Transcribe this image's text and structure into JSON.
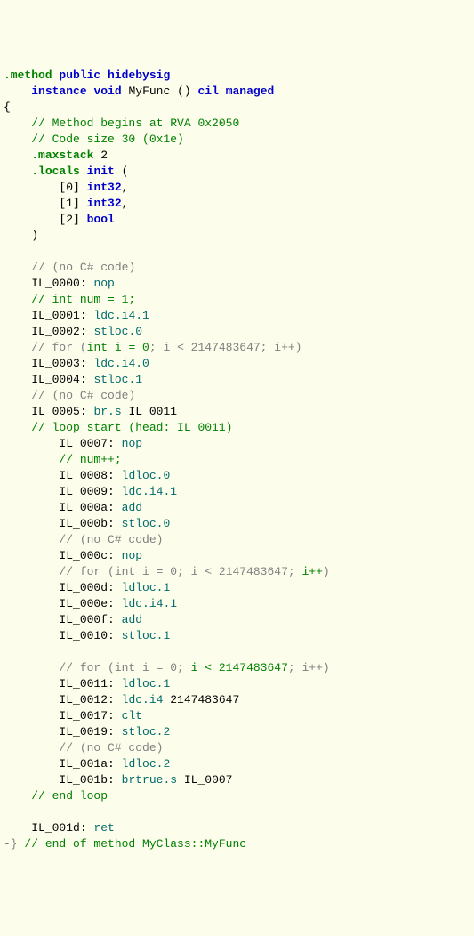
{
  "lines": [
    {
      "indent": 0,
      "parts": [
        {
          "cls": "kw-dir",
          "t": ".method"
        },
        {
          "cls": "plain",
          "t": " "
        },
        {
          "cls": "kw-blue",
          "t": "public"
        },
        {
          "cls": "plain",
          "t": " "
        },
        {
          "cls": "kw-blue",
          "t": "hidebysig"
        }
      ]
    },
    {
      "indent": 4,
      "parts": [
        {
          "cls": "kw-blue",
          "t": "instance"
        },
        {
          "cls": "plain",
          "t": " "
        },
        {
          "cls": "kw-blue",
          "t": "void"
        },
        {
          "cls": "plain",
          "t": " MyFunc () "
        },
        {
          "cls": "kw-blue",
          "t": "cil managed"
        }
      ]
    },
    {
      "indent": 0,
      "parts": [
        {
          "cls": "plain",
          "t": "{"
        }
      ]
    },
    {
      "indent": 4,
      "parts": [
        {
          "cls": "comment",
          "t": "// Method begins at RVA 0x2050"
        }
      ]
    },
    {
      "indent": 4,
      "parts": [
        {
          "cls": "comment",
          "t": "// Code size 30 (0x1e)"
        }
      ]
    },
    {
      "indent": 4,
      "parts": [
        {
          "cls": "kw-dir",
          "t": ".maxstack"
        },
        {
          "cls": "plain",
          "t": " 2"
        }
      ]
    },
    {
      "indent": 4,
      "parts": [
        {
          "cls": "kw-dir",
          "t": ".locals"
        },
        {
          "cls": "plain",
          "t": " "
        },
        {
          "cls": "kw-blue",
          "t": "init"
        },
        {
          "cls": "plain",
          "t": " ("
        }
      ]
    },
    {
      "indent": 8,
      "parts": [
        {
          "cls": "plain",
          "t": "[0] "
        },
        {
          "cls": "kw-type",
          "t": "int32"
        },
        {
          "cls": "plain",
          "t": ","
        }
      ]
    },
    {
      "indent": 8,
      "parts": [
        {
          "cls": "plain",
          "t": "[1] "
        },
        {
          "cls": "kw-type",
          "t": "int32"
        },
        {
          "cls": "plain",
          "t": ","
        }
      ]
    },
    {
      "indent": 8,
      "parts": [
        {
          "cls": "plain",
          "t": "[2] "
        },
        {
          "cls": "kw-type",
          "t": "bool"
        }
      ]
    },
    {
      "indent": 4,
      "parts": [
        {
          "cls": "plain",
          "t": ")"
        }
      ]
    },
    {
      "indent": 0,
      "parts": []
    },
    {
      "indent": 4,
      "parts": [
        {
          "cls": "comment-grey",
          "t": "// "
        },
        {
          "cls": "comment-grey",
          "t": "(no C# code)"
        }
      ]
    },
    {
      "indent": 4,
      "parts": [
        {
          "cls": "label",
          "t": "IL_0000: "
        },
        {
          "cls": "opcode",
          "t": "nop"
        }
      ]
    },
    {
      "indent": 4,
      "parts": [
        {
          "cls": "comment",
          "t": "// int num = 1;"
        }
      ]
    },
    {
      "indent": 4,
      "parts": [
        {
          "cls": "label",
          "t": "IL_0001: "
        },
        {
          "cls": "opcode",
          "t": "ldc.i4.1"
        }
      ]
    },
    {
      "indent": 4,
      "parts": [
        {
          "cls": "label",
          "t": "IL_0002: "
        },
        {
          "cls": "opcode",
          "t": "stloc.0"
        }
      ]
    },
    {
      "indent": 4,
      "parts": [
        {
          "cls": "comment-grey",
          "t": "// for ("
        },
        {
          "cls": "comment",
          "t": "int i = 0"
        },
        {
          "cls": "comment-grey",
          "t": "; i < 2147483647; i++)"
        }
      ]
    },
    {
      "indent": 4,
      "parts": [
        {
          "cls": "label",
          "t": "IL_0003: "
        },
        {
          "cls": "opcode",
          "t": "ldc.i4.0"
        }
      ]
    },
    {
      "indent": 4,
      "parts": [
        {
          "cls": "label",
          "t": "IL_0004: "
        },
        {
          "cls": "opcode",
          "t": "stloc.1"
        }
      ]
    },
    {
      "indent": 4,
      "parts": [
        {
          "cls": "comment-grey",
          "t": "// (no C# code)"
        }
      ]
    },
    {
      "indent": 4,
      "parts": [
        {
          "cls": "label",
          "t": "IL_0005: "
        },
        {
          "cls": "opcode",
          "t": "br.s"
        },
        {
          "cls": "plain",
          "t": " IL_0011"
        }
      ]
    },
    {
      "indent": 4,
      "parts": [
        {
          "cls": "comment",
          "t": "// loop start (head: IL_0011)"
        }
      ]
    },
    {
      "indent": 8,
      "parts": [
        {
          "cls": "label",
          "t": "IL_0007: "
        },
        {
          "cls": "opcode",
          "t": "nop"
        }
      ]
    },
    {
      "indent": 8,
      "parts": [
        {
          "cls": "comment",
          "t": "// num++;"
        }
      ]
    },
    {
      "indent": 8,
      "parts": [
        {
          "cls": "label",
          "t": "IL_0008: "
        },
        {
          "cls": "opcode",
          "t": "ldloc.0"
        }
      ]
    },
    {
      "indent": 8,
      "parts": [
        {
          "cls": "label",
          "t": "IL_0009: "
        },
        {
          "cls": "opcode",
          "t": "ldc.i4.1"
        }
      ]
    },
    {
      "indent": 8,
      "parts": [
        {
          "cls": "label",
          "t": "IL_000a: "
        },
        {
          "cls": "opcode",
          "t": "add"
        }
      ]
    },
    {
      "indent": 8,
      "parts": [
        {
          "cls": "label",
          "t": "IL_000b: "
        },
        {
          "cls": "opcode",
          "t": "stloc.0"
        }
      ]
    },
    {
      "indent": 8,
      "parts": [
        {
          "cls": "comment-grey",
          "t": "// (no C# code)"
        }
      ]
    },
    {
      "indent": 8,
      "parts": [
        {
          "cls": "label",
          "t": "IL_000c: "
        },
        {
          "cls": "opcode",
          "t": "nop"
        }
      ]
    },
    {
      "indent": 8,
      "parts": [
        {
          "cls": "comment-grey",
          "t": "// for (int i = 0; i < 2147483647; "
        },
        {
          "cls": "comment",
          "t": "i++"
        },
        {
          "cls": "comment-grey",
          "t": ")"
        }
      ]
    },
    {
      "indent": 8,
      "parts": [
        {
          "cls": "label",
          "t": "IL_000d: "
        },
        {
          "cls": "opcode",
          "t": "ldloc.1"
        }
      ]
    },
    {
      "indent": 8,
      "parts": [
        {
          "cls": "label",
          "t": "IL_000e: "
        },
        {
          "cls": "opcode",
          "t": "ldc.i4.1"
        }
      ]
    },
    {
      "indent": 8,
      "parts": [
        {
          "cls": "label",
          "t": "IL_000f: "
        },
        {
          "cls": "opcode",
          "t": "add"
        }
      ]
    },
    {
      "indent": 8,
      "parts": [
        {
          "cls": "label",
          "t": "IL_0010: "
        },
        {
          "cls": "opcode",
          "t": "stloc.1"
        }
      ]
    },
    {
      "indent": 0,
      "parts": []
    },
    {
      "indent": 8,
      "parts": [
        {
          "cls": "comment-grey",
          "t": "// for (int i = 0; "
        },
        {
          "cls": "comment",
          "t": "i < 2147483647"
        },
        {
          "cls": "comment-grey",
          "t": "; i++)"
        }
      ]
    },
    {
      "indent": 8,
      "parts": [
        {
          "cls": "label",
          "t": "IL_0011: "
        },
        {
          "cls": "opcode",
          "t": "ldloc.1"
        }
      ]
    },
    {
      "indent": 8,
      "parts": [
        {
          "cls": "label",
          "t": "IL_0012: "
        },
        {
          "cls": "opcode",
          "t": "ldc.i4"
        },
        {
          "cls": "plain",
          "t": " 2147483647"
        }
      ]
    },
    {
      "indent": 8,
      "parts": [
        {
          "cls": "label",
          "t": "IL_0017: "
        },
        {
          "cls": "opcode",
          "t": "clt"
        }
      ]
    },
    {
      "indent": 8,
      "parts": [
        {
          "cls": "label",
          "t": "IL_0019: "
        },
        {
          "cls": "opcode",
          "t": "stloc.2"
        }
      ]
    },
    {
      "indent": 8,
      "parts": [
        {
          "cls": "comment-grey",
          "t": "// (no C# code)"
        }
      ]
    },
    {
      "indent": 8,
      "parts": [
        {
          "cls": "label",
          "t": "IL_001a: "
        },
        {
          "cls": "opcode",
          "t": "ldloc.2"
        }
      ]
    },
    {
      "indent": 8,
      "parts": [
        {
          "cls": "label",
          "t": "IL_001b: "
        },
        {
          "cls": "opcode",
          "t": "brtrue.s"
        },
        {
          "cls": "plain",
          "t": " IL_0007"
        }
      ]
    },
    {
      "indent": 4,
      "parts": [
        {
          "cls": "comment",
          "t": "// end loop"
        }
      ]
    },
    {
      "indent": 0,
      "parts": []
    },
    {
      "indent": 4,
      "parts": [
        {
          "cls": "label",
          "t": "IL_001d: "
        },
        {
          "cls": "opcode",
          "t": "ret"
        }
      ]
    }
  ],
  "endline_prefix": "-}",
  "endline_comment": " // end of method MyClass::MyFunc"
}
